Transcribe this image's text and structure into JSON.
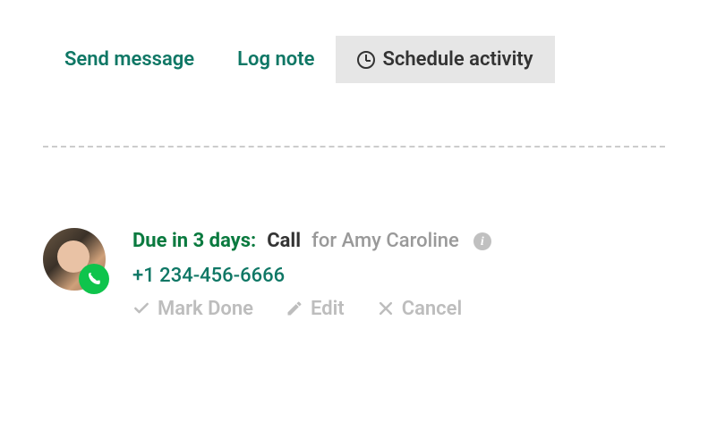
{
  "tabs": {
    "send_message": "Send message",
    "log_note": "Log note",
    "schedule_activity": "Schedule activity"
  },
  "activity": {
    "due_label": "Due in 3 days:",
    "type": "Call",
    "assignee": "for Amy Caroline",
    "phone": "+1 234-456-6666"
  },
  "actions": {
    "mark_done": "Mark Done",
    "edit": "Edit",
    "cancel": "Cancel"
  }
}
